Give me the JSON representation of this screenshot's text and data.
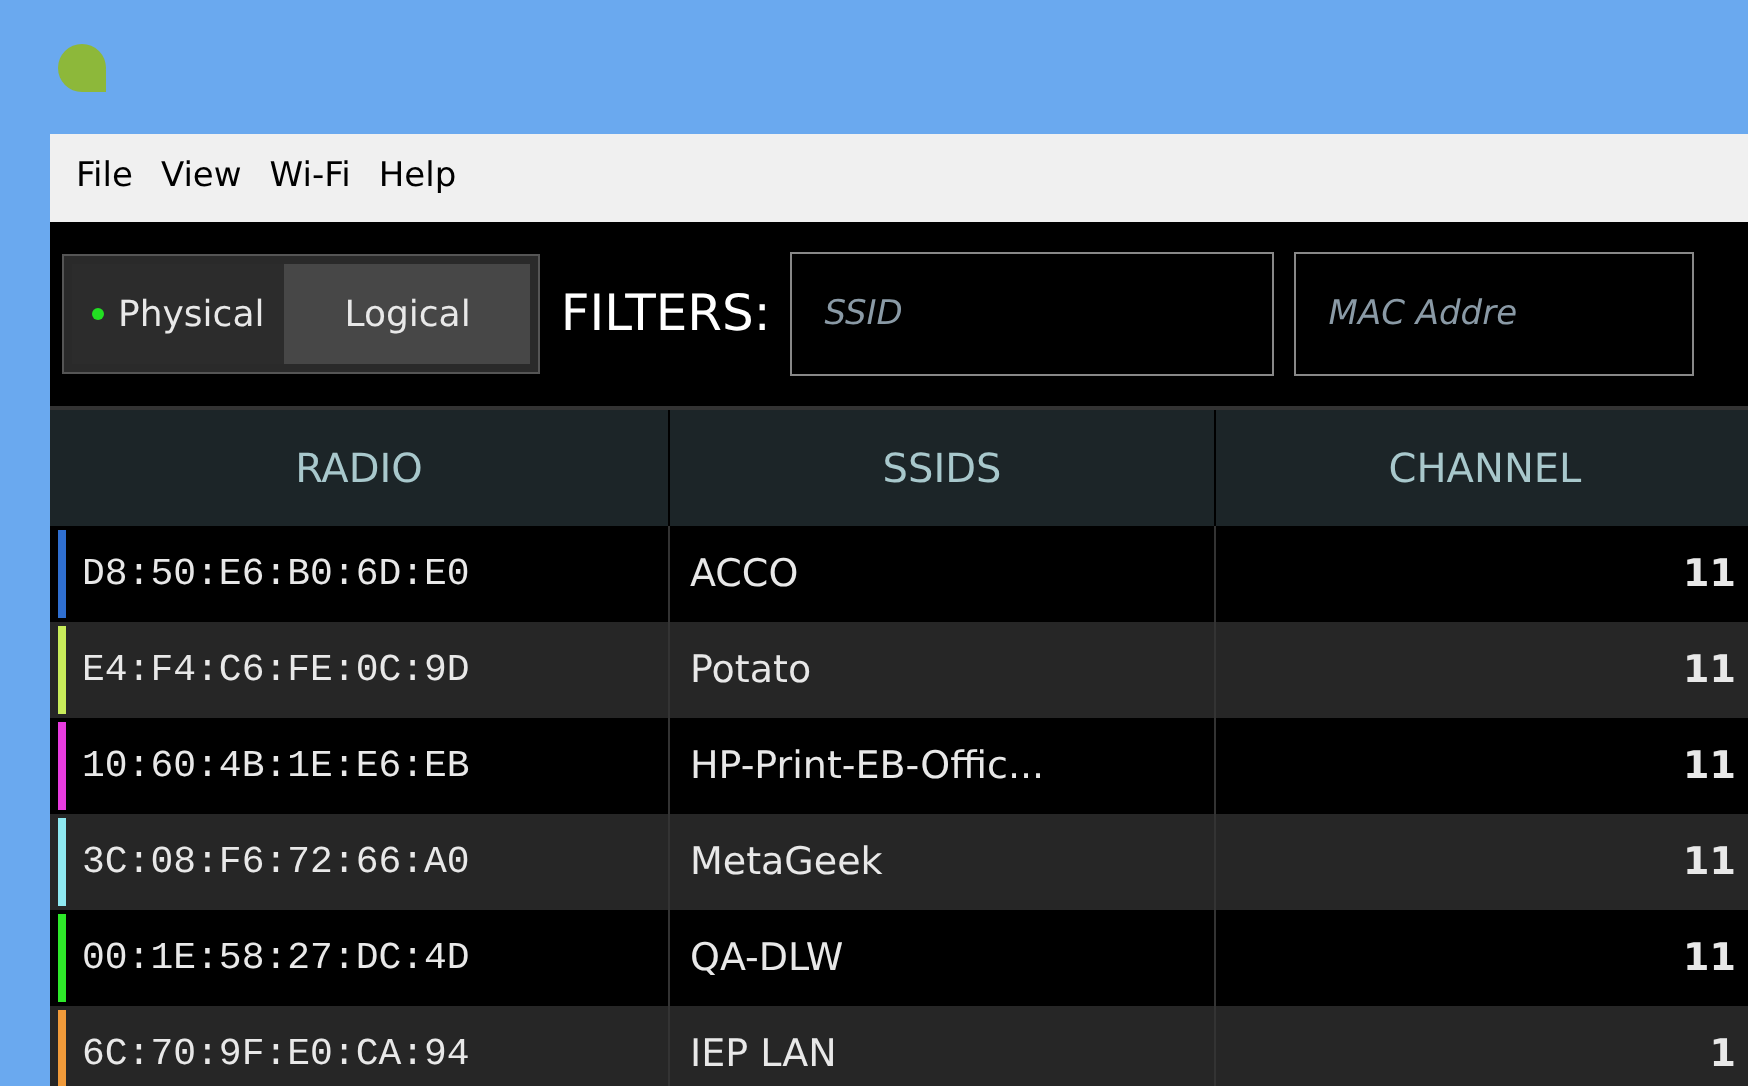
{
  "menu": [
    "File",
    "View",
    "Wi-Fi",
    "Help"
  ],
  "view_toggle": [
    {
      "label": "Physical",
      "selected": true
    },
    {
      "label": "Logical",
      "selected": false
    }
  ],
  "filters": {
    "label": "FILTERS:",
    "fields": [
      {
        "placeholder": "SSID"
      },
      {
        "placeholder": "MAC Addre"
      }
    ]
  },
  "table": {
    "columns": [
      "RADIO",
      "SSIDS",
      "CHANNEL"
    ],
    "rows": [
      {
        "radio": "D8:50:E6:B0:6D:E0",
        "ssids": "ACCO",
        "channel": "11",
        "color": "#2f6fd0"
      },
      {
        "radio": "E4:F4:C6:FE:0C:9D",
        "ssids": "Potato",
        "channel": "11",
        "color": "#c8ec5a"
      },
      {
        "radio": "10:60:4B:1E:E6:EB",
        "ssids": "HP-Print-EB-Offic...",
        "channel": "11",
        "color": "#e83ce0"
      },
      {
        "radio": "3C:08:F6:72:66:A0",
        "ssids": "MetaGeek",
        "channel": "11",
        "color": "#8ee8f0"
      },
      {
        "radio": "00:1E:58:27:DC:4D",
        "ssids": "QA-DLW",
        "channel": "11",
        "color": "#2ee82a"
      },
      {
        "radio": "6C:70:9F:E0:CA:94",
        "ssids": "IEP LAN",
        "channel": "1",
        "color": "#f09a3a"
      }
    ]
  }
}
